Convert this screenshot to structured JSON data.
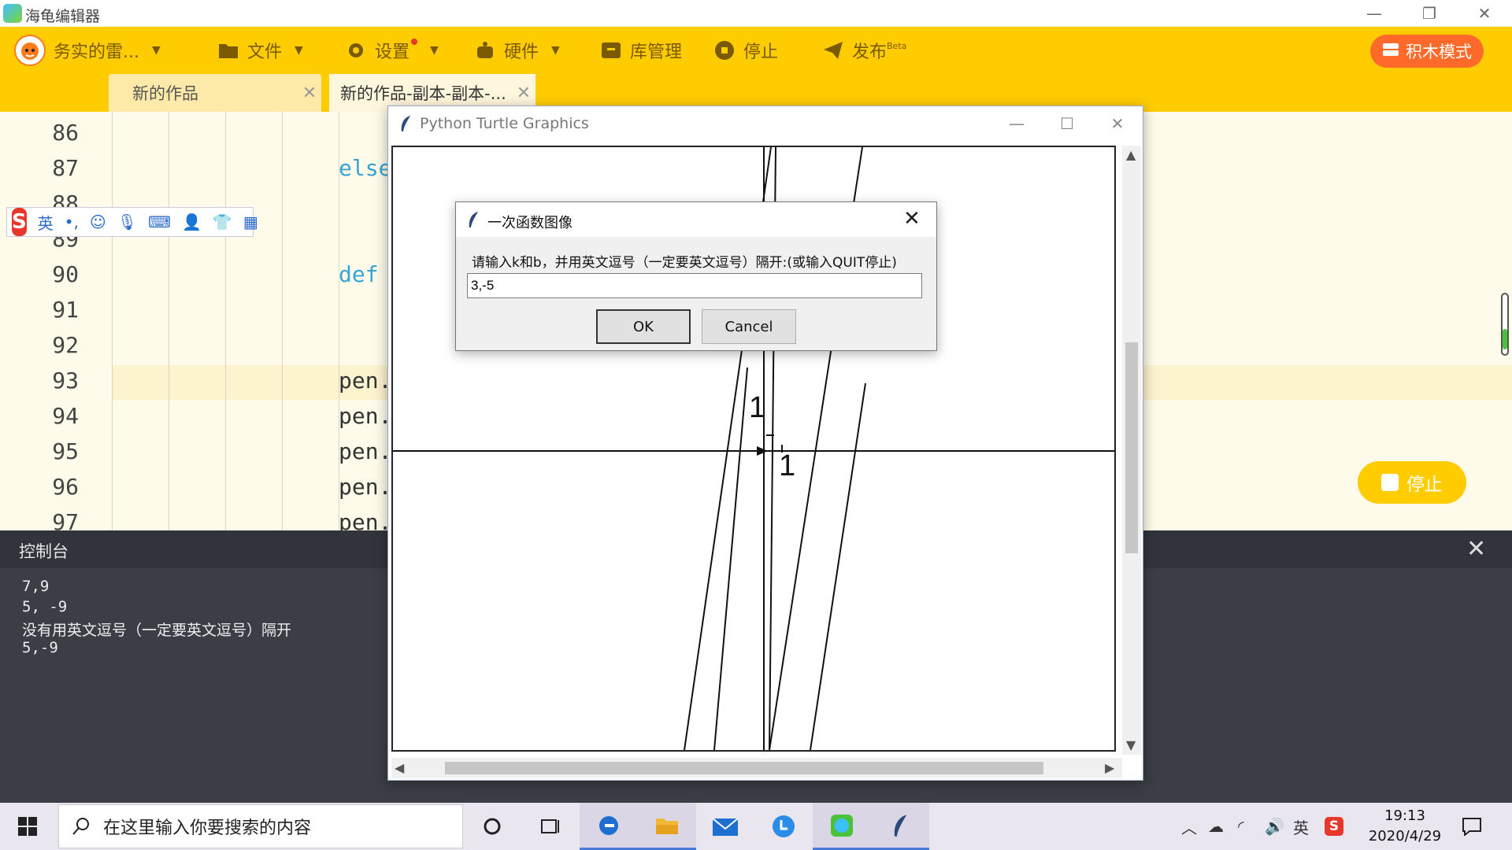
{
  "window": {
    "app_title": "海龟编辑器"
  },
  "toolbar": {
    "user_label": "务实的雷...",
    "file_label": "文件",
    "settings_label": "设置",
    "hardware_label": "硬件",
    "library_label": "库管理",
    "stop_label": "停止",
    "publish_label": "发布",
    "publish_badge": "Beta",
    "block_mode_label": "积木模式"
  },
  "tabs": [
    {
      "label": "新的作品"
    },
    {
      "label": "新的作品-副本-副本-..."
    }
  ],
  "editor": {
    "lines": [
      {
        "num": "86",
        "code": ""
      },
      {
        "num": "87",
        "code": "else"
      },
      {
        "num": "88",
        "code": ""
      },
      {
        "num": "89",
        "code": ""
      },
      {
        "num": "90",
        "code": "def"
      },
      {
        "num": "91",
        "code": ""
      },
      {
        "num": "92",
        "code": ""
      },
      {
        "num": "93",
        "code": "pen."
      },
      {
        "num": "94",
        "code": "pen."
      },
      {
        "num": "95",
        "code": "pen."
      },
      {
        "num": "96",
        "code": "pen."
      },
      {
        "num": "97",
        "code": "pen."
      }
    ]
  },
  "ime": {
    "mode_label": "英",
    "punct": "•,"
  },
  "float_stop_label": "停止",
  "console": {
    "title": "控制台",
    "lines": [
      "7,9",
      "5, -9",
      "没有用英文逗号（一定要英文逗号）隔开",
      "5,-9"
    ]
  },
  "turtle_window": {
    "title": "Python Turtle Graphics",
    "label_y": "1",
    "label_x": "1"
  },
  "dialog": {
    "title": "一次函数图像",
    "prompt": "请输入k和b，并用英文逗号（一定要英文逗号）隔开:(或输入QUIT停止)",
    "input_value": "3,-5",
    "ok_label": "OK",
    "cancel_label": "Cancel"
  },
  "taskbar": {
    "search_placeholder": "在这里输入你要搜索的内容",
    "ime_tray": "英",
    "time": "19:13",
    "date": "2020/4/29"
  },
  "colors": {
    "toolbar_bg": "#ffcc00",
    "block_mode_btn": "#ff6a2a",
    "console_bg": "#3b3e44",
    "keyword": "#3aa3d4"
  }
}
